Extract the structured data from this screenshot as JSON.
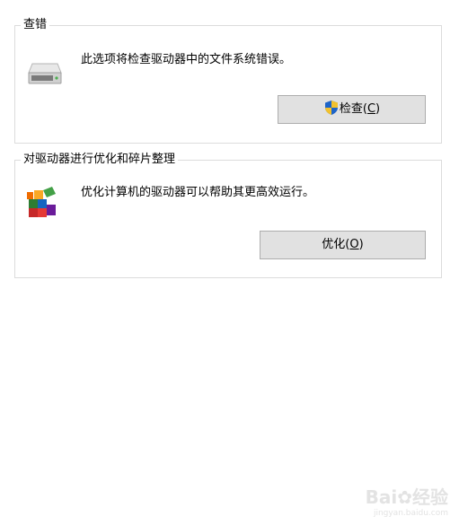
{
  "error_check": {
    "title": "查错",
    "description": "此选项将检查驱动器中的文件系统错误。",
    "button_text": "检查(",
    "button_key": "C",
    "button_close": ")"
  },
  "optimize": {
    "title": "对驱动器进行优化和碎片整理",
    "description": "优化计算机的驱动器可以帮助其更高效运行。",
    "button_text": "优化(",
    "button_key": "O",
    "button_close": ")"
  },
  "watermark": {
    "brand": "Bai",
    "brand_cn": "经验",
    "sub": "jingyan.baidu.com"
  },
  "icons": {
    "drive": "hard-drive-icon",
    "shield": "uac-shield-icon",
    "defrag": "defrag-blocks-icon"
  }
}
